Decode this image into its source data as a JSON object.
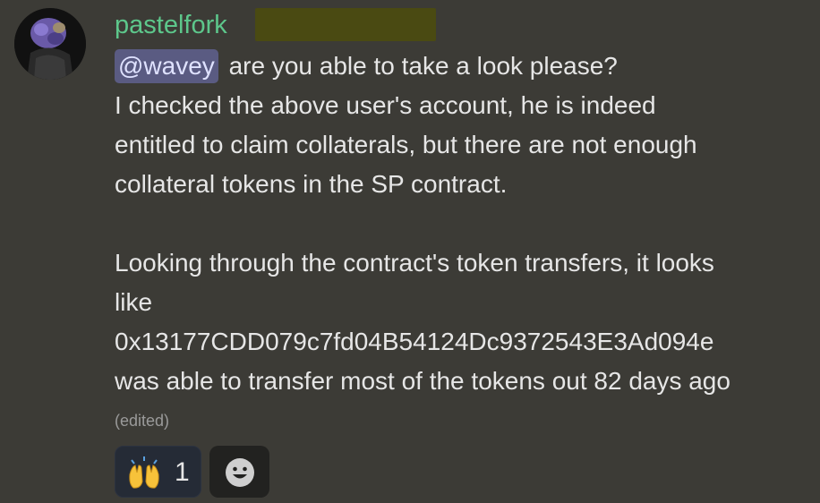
{
  "author": {
    "username": "pastelfork",
    "avatar_icon": "avatar-image",
    "username_color": "#5dc78b",
    "role_badge_color": "#4a4a12"
  },
  "message": {
    "mention": "@wavey",
    "lines": [
      " are you able to take a look please?",
      "I checked the above user's account, he is indeed",
      "entitled to claim collaterals, but there are not enough",
      "collateral tokens in the SP contract.",
      "",
      "Looking through the contract's token transfers, it looks",
      "like",
      "0x13177CDD079c7fd04B54124Dc9372543E3Ad094e",
      "was able to transfer most of the tokens out 82 days ago"
    ],
    "edited_label": "(edited)"
  },
  "reactions": [
    {
      "emoji": "🙌",
      "icon": "raised-hands-icon",
      "count": "1"
    }
  ],
  "add_reaction": {
    "icon": "smiley-add-reaction-icon"
  },
  "colors": {
    "background": "#3c3b36",
    "mention_bg": "#5a5b82",
    "reaction_bg": "#252b36"
  }
}
